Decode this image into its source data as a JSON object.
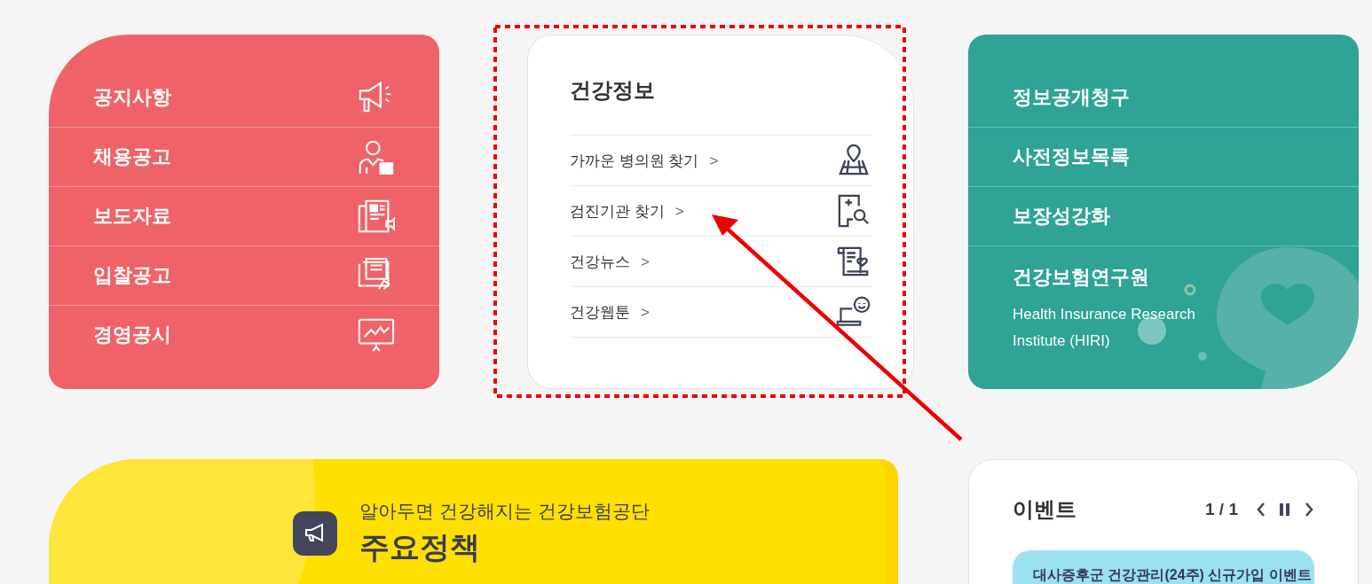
{
  "notice_menu": {
    "items": [
      {
        "label": "공지사항"
      },
      {
        "label": "채용공고"
      },
      {
        "label": "보도자료"
      },
      {
        "label": "입찰공고"
      },
      {
        "label": "경영공시"
      }
    ]
  },
  "health_info": {
    "title": "건강정보",
    "links": [
      {
        "label": "가까운 병의원 찾기",
        "arrow": ">"
      },
      {
        "label": "검진기관 찾기",
        "arrow": ">"
      },
      {
        "label": "건강뉴스",
        "arrow": ">"
      },
      {
        "label": "건강웹툰",
        "arrow": ">"
      }
    ]
  },
  "disclosure_menu": {
    "items": [
      {
        "label": "정보공개청구"
      },
      {
        "label": "사전정보목록"
      },
      {
        "label": "보장성강화"
      }
    ],
    "institute": {
      "title": "건강보험연구원",
      "subtitle": "Health Insurance Research Institute (HIRI)"
    }
  },
  "policy_banner": {
    "subtitle": "알아두면 건강해지는 건강보험공단",
    "title": "주요정책"
  },
  "events": {
    "title": "이벤트",
    "pager": "1 / 1",
    "items": [
      {
        "label": "대사증후군 건강관리(24주) 신규가입 이벤트"
      }
    ]
  }
}
